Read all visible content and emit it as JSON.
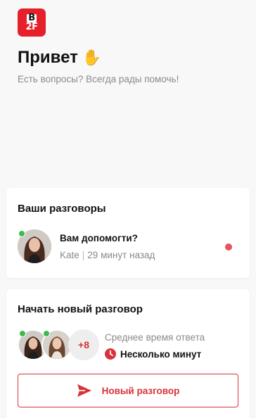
{
  "brand": {
    "logo_line1": "B",
    "logo_line2": "2F",
    "logo_color": "#e5202a"
  },
  "header": {
    "greeting": "Привет",
    "greeting_emoji": "✋",
    "subtitle": "Есть вопросы? Всегда рады помочь!"
  },
  "conversations": {
    "title": "Ваши разговоры",
    "items": [
      {
        "title": "Вам допомогти?",
        "agent": "Kate",
        "separator": "|",
        "time": "29 минут назад",
        "online": true,
        "unread": true
      }
    ]
  },
  "new_conversation": {
    "title": "Начать новый разговор",
    "more_agents": "+8",
    "response_label": "Среднее время ответа",
    "response_value": "Несколько минут",
    "button_label": "Новый разговор"
  },
  "colors": {
    "accent": "#d8323a",
    "online": "#3dbb4f",
    "unread": "#e5535e",
    "muted_text": "#8a8a8a",
    "background": "#f8f8f8"
  },
  "icons": {
    "clock": "clock-icon",
    "send": "send-icon",
    "online": "online-indicator",
    "unread": "unread-dot"
  }
}
